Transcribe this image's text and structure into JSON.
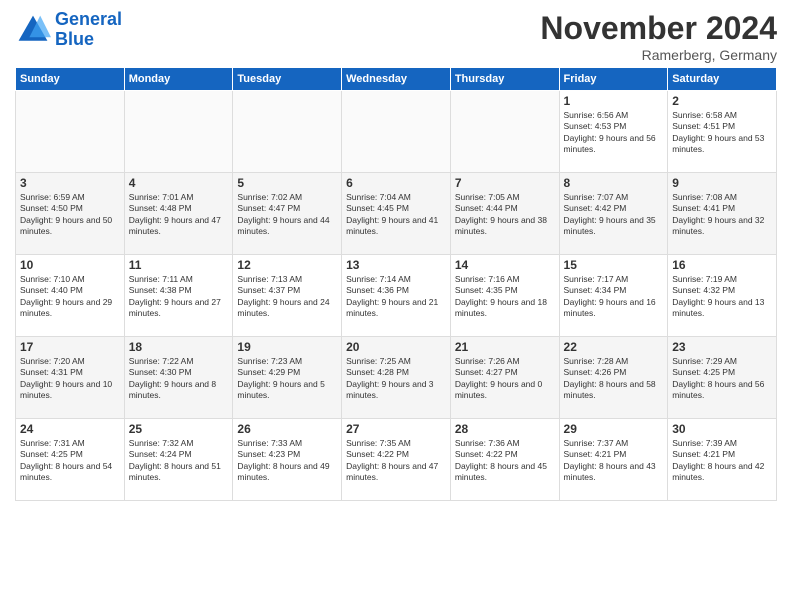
{
  "logo": {
    "line1": "General",
    "line2": "Blue"
  },
  "title": "November 2024",
  "subtitle": "Ramerberg, Germany",
  "headers": [
    "Sunday",
    "Monday",
    "Tuesday",
    "Wednesday",
    "Thursday",
    "Friday",
    "Saturday"
  ],
  "weeks": [
    [
      {
        "day": "",
        "info": ""
      },
      {
        "day": "",
        "info": ""
      },
      {
        "day": "",
        "info": ""
      },
      {
        "day": "",
        "info": ""
      },
      {
        "day": "",
        "info": ""
      },
      {
        "day": "1",
        "info": "Sunrise: 6:56 AM\nSunset: 4:53 PM\nDaylight: 9 hours and 56 minutes."
      },
      {
        "day": "2",
        "info": "Sunrise: 6:58 AM\nSunset: 4:51 PM\nDaylight: 9 hours and 53 minutes."
      }
    ],
    [
      {
        "day": "3",
        "info": "Sunrise: 6:59 AM\nSunset: 4:50 PM\nDaylight: 9 hours and 50 minutes."
      },
      {
        "day": "4",
        "info": "Sunrise: 7:01 AM\nSunset: 4:48 PM\nDaylight: 9 hours and 47 minutes."
      },
      {
        "day": "5",
        "info": "Sunrise: 7:02 AM\nSunset: 4:47 PM\nDaylight: 9 hours and 44 minutes."
      },
      {
        "day": "6",
        "info": "Sunrise: 7:04 AM\nSunset: 4:45 PM\nDaylight: 9 hours and 41 minutes."
      },
      {
        "day": "7",
        "info": "Sunrise: 7:05 AM\nSunset: 4:44 PM\nDaylight: 9 hours and 38 minutes."
      },
      {
        "day": "8",
        "info": "Sunrise: 7:07 AM\nSunset: 4:42 PM\nDaylight: 9 hours and 35 minutes."
      },
      {
        "day": "9",
        "info": "Sunrise: 7:08 AM\nSunset: 4:41 PM\nDaylight: 9 hours and 32 minutes."
      }
    ],
    [
      {
        "day": "10",
        "info": "Sunrise: 7:10 AM\nSunset: 4:40 PM\nDaylight: 9 hours and 29 minutes."
      },
      {
        "day": "11",
        "info": "Sunrise: 7:11 AM\nSunset: 4:38 PM\nDaylight: 9 hours and 27 minutes."
      },
      {
        "day": "12",
        "info": "Sunrise: 7:13 AM\nSunset: 4:37 PM\nDaylight: 9 hours and 24 minutes."
      },
      {
        "day": "13",
        "info": "Sunrise: 7:14 AM\nSunset: 4:36 PM\nDaylight: 9 hours and 21 minutes."
      },
      {
        "day": "14",
        "info": "Sunrise: 7:16 AM\nSunset: 4:35 PM\nDaylight: 9 hours and 18 minutes."
      },
      {
        "day": "15",
        "info": "Sunrise: 7:17 AM\nSunset: 4:34 PM\nDaylight: 9 hours and 16 minutes."
      },
      {
        "day": "16",
        "info": "Sunrise: 7:19 AM\nSunset: 4:32 PM\nDaylight: 9 hours and 13 minutes."
      }
    ],
    [
      {
        "day": "17",
        "info": "Sunrise: 7:20 AM\nSunset: 4:31 PM\nDaylight: 9 hours and 10 minutes."
      },
      {
        "day": "18",
        "info": "Sunrise: 7:22 AM\nSunset: 4:30 PM\nDaylight: 9 hours and 8 minutes."
      },
      {
        "day": "19",
        "info": "Sunrise: 7:23 AM\nSunset: 4:29 PM\nDaylight: 9 hours and 5 minutes."
      },
      {
        "day": "20",
        "info": "Sunrise: 7:25 AM\nSunset: 4:28 PM\nDaylight: 9 hours and 3 minutes."
      },
      {
        "day": "21",
        "info": "Sunrise: 7:26 AM\nSunset: 4:27 PM\nDaylight: 9 hours and 0 minutes."
      },
      {
        "day": "22",
        "info": "Sunrise: 7:28 AM\nSunset: 4:26 PM\nDaylight: 8 hours and 58 minutes."
      },
      {
        "day": "23",
        "info": "Sunrise: 7:29 AM\nSunset: 4:25 PM\nDaylight: 8 hours and 56 minutes."
      }
    ],
    [
      {
        "day": "24",
        "info": "Sunrise: 7:31 AM\nSunset: 4:25 PM\nDaylight: 8 hours and 54 minutes."
      },
      {
        "day": "25",
        "info": "Sunrise: 7:32 AM\nSunset: 4:24 PM\nDaylight: 8 hours and 51 minutes."
      },
      {
        "day": "26",
        "info": "Sunrise: 7:33 AM\nSunset: 4:23 PM\nDaylight: 8 hours and 49 minutes."
      },
      {
        "day": "27",
        "info": "Sunrise: 7:35 AM\nSunset: 4:22 PM\nDaylight: 8 hours and 47 minutes."
      },
      {
        "day": "28",
        "info": "Sunrise: 7:36 AM\nSunset: 4:22 PM\nDaylight: 8 hours and 45 minutes."
      },
      {
        "day": "29",
        "info": "Sunrise: 7:37 AM\nSunset: 4:21 PM\nDaylight: 8 hours and 43 minutes."
      },
      {
        "day": "30",
        "info": "Sunrise: 7:39 AM\nSunset: 4:21 PM\nDaylight: 8 hours and 42 minutes."
      }
    ]
  ]
}
